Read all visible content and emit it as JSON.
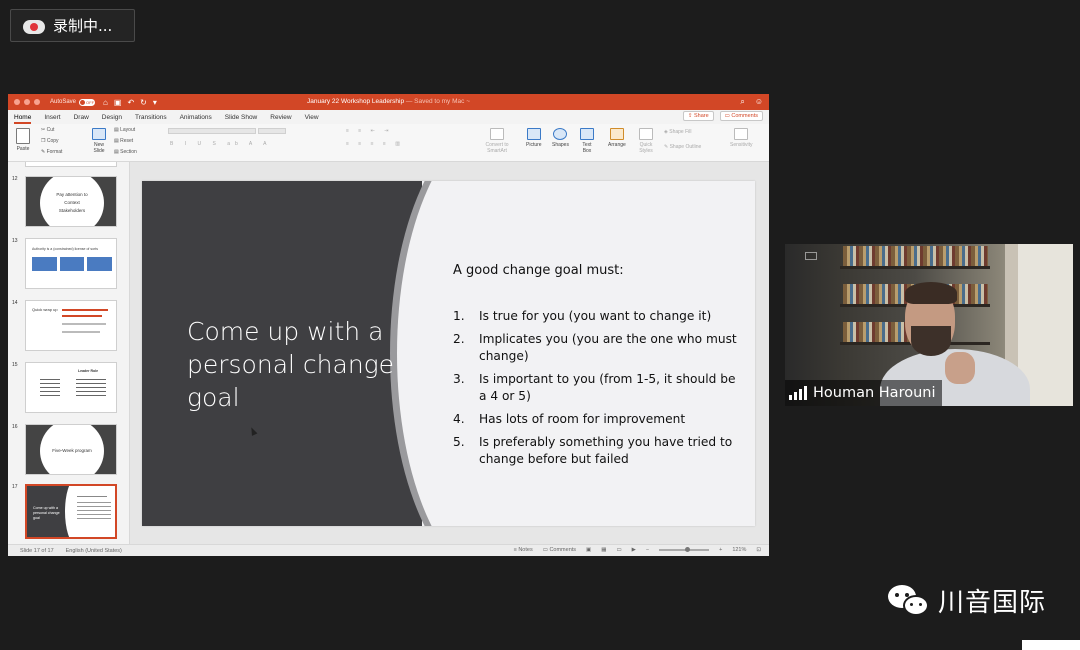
{
  "recording": {
    "label": "录制中..."
  },
  "ppt": {
    "titlebar": {
      "autosave_label": "AutoSave",
      "autosave_state": "OFF",
      "doc_title": "January 22 Workshop Leadership",
      "doc_subtitle": "— Saved to my Mac ~"
    },
    "tabs": [
      "Home",
      "Insert",
      "Draw",
      "Design",
      "Transitions",
      "Animations",
      "Slide Show",
      "Review",
      "View"
    ],
    "share_label": "Share",
    "comments_label": "Comments",
    "ribbon": {
      "paste": "Paste",
      "cut": "Cut",
      "copy": "Copy",
      "format": "Format",
      "new_slide": "New Slide",
      "layout": "Layout",
      "reset": "Reset",
      "section": "Section",
      "convert_smartart": "Convert to SmartArt",
      "picture": "Picture",
      "shapes": "Shapes",
      "text_box": "Text Box",
      "arrange": "Arrange",
      "quick_styles": "Quick Styles",
      "shape_fill": "Shape Fill",
      "shape_outline": "Shape Outline",
      "sensitivity": "Sensitivity"
    },
    "thumbnails": [
      {
        "num": "12",
        "lines": [
          "Pay attention to",
          "Context",
          "Stakeholders"
        ]
      },
      {
        "num": "13",
        "title": "Authority is a (constrained) license of sorts"
      },
      {
        "num": "14",
        "title": "Quick wrap up"
      },
      {
        "num": "15",
        "title": "Leader Role"
      },
      {
        "num": "16",
        "lines": [
          "Five-Week program"
        ]
      },
      {
        "num": "17",
        "title": "Come up with a personal change goal"
      }
    ],
    "slide": {
      "title": "Come up with a personal change goal",
      "heading": "A good change goal must:",
      "items": [
        {
          "n": "1.",
          "text": "Is true for you (you want to change it)"
        },
        {
          "n": "2.",
          "text": "Implicates you (you are the one who must change)"
        },
        {
          "n": "3.",
          "text": "Is important to you (from 1-5, it should be a 4 or 5)"
        },
        {
          "n": "4.",
          "text": "Has lots of room for improvement"
        },
        {
          "n": "5.",
          "text": "Is preferably something you have tried to change before but failed"
        }
      ]
    },
    "status": {
      "slide_info": "Slide 17 of 17",
      "language": "English (United States)",
      "notes": "Notes",
      "comments": "Comments",
      "zoom": "121%"
    }
  },
  "webcam": {
    "name": "Houman Harouni"
  },
  "watermark": {
    "text": "川音国际"
  },
  "colors": {
    "accent": "#d24726",
    "slide_dark": "#3f3f42",
    "background": "#1c1c1c"
  }
}
